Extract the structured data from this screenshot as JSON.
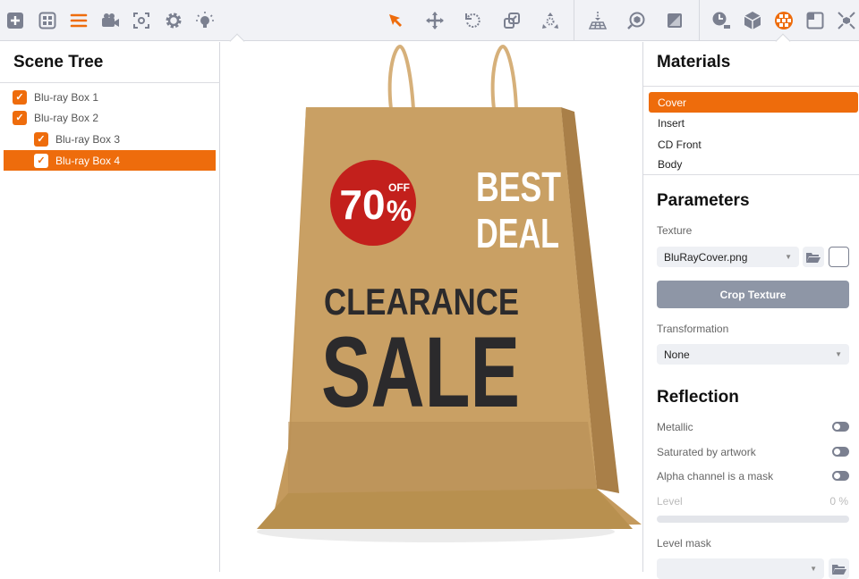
{
  "toolbar": {
    "left_icons": [
      "add-icon",
      "layout-icon",
      "scene-tree-icon",
      "camera-icon",
      "focus-icon",
      "settings-icon",
      "light-icon"
    ],
    "center_icons": [
      "select-arrow-icon",
      "move-icon",
      "rotate-icon",
      "scale-icon",
      "explode-icon",
      "drop-to-floor-icon",
      "view-object-icon",
      "shadow-icon"
    ],
    "right_icons": [
      "animation-icon",
      "object-icon",
      "materials-icon",
      "frame-icon",
      "fit-icon"
    ],
    "accent": "#ee6c0c"
  },
  "scene_tree": {
    "title": "Scene Tree",
    "items": [
      {
        "label": "Blu-ray Box 1"
      },
      {
        "label": "Blu-ray Box 2"
      },
      {
        "label": "Blu-ray Box 3"
      },
      {
        "label": "Blu-ray Box 4"
      }
    ]
  },
  "viewport": {
    "badge_percent": "70",
    "badge_off": "OFF",
    "badge_sign": "%",
    "best": "BEST",
    "deal": "DEAL",
    "clearance": "CLEARANCE",
    "sale": "SALE"
  },
  "materials": {
    "title": "Materials",
    "items": [
      "Cover",
      "Insert",
      "CD Front",
      "Body"
    ]
  },
  "parameters": {
    "title": "Parameters",
    "texture_label": "Texture",
    "texture_value": "BluRayCover.png",
    "crop_label": "Crop Texture",
    "transformation_label": "Transformation",
    "transformation_value": "None"
  },
  "reflection": {
    "title": "Reflection",
    "metallic": "Metallic",
    "saturated": "Saturated by artwork",
    "alpha": "Alpha channel is a mask",
    "level_label": "Level",
    "level_value": "0 %",
    "level_fraction": 0,
    "level_mask_label": "Level mask"
  }
}
